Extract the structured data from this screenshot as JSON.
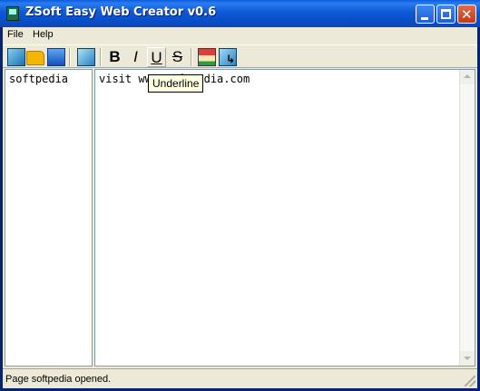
{
  "window": {
    "title": "ZSoft Easy Web Creator v0.6"
  },
  "menu": {
    "items": [
      "File",
      "Help"
    ]
  },
  "toolbar": {
    "tools": [
      {
        "name": "new-page-icon",
        "color": "#2f8fc8"
      },
      {
        "name": "open-folder-icon",
        "color": "#f2b705"
      },
      {
        "name": "save-icon",
        "color": "#1e66c9"
      },
      {
        "name": "copy-page-icon",
        "color": "#3a8fd0"
      }
    ],
    "format": [
      {
        "name": "bold-button",
        "label": "B"
      },
      {
        "name": "italic-button",
        "label": "I"
      },
      {
        "name": "underline-button",
        "label": "U"
      },
      {
        "name": "strikethrough-button",
        "label": "S"
      }
    ],
    "extra": [
      {
        "name": "home-page-icon",
        "color": "#2e9c3a"
      },
      {
        "name": "insert-link-icon",
        "color": "#2b7fc4"
      }
    ]
  },
  "pages": [
    "softpedia"
  ],
  "editor": {
    "text": "visit www.softpedia.com"
  },
  "tooltip": {
    "text": "Underline"
  },
  "status": {
    "text": "Page softpedia opened."
  }
}
